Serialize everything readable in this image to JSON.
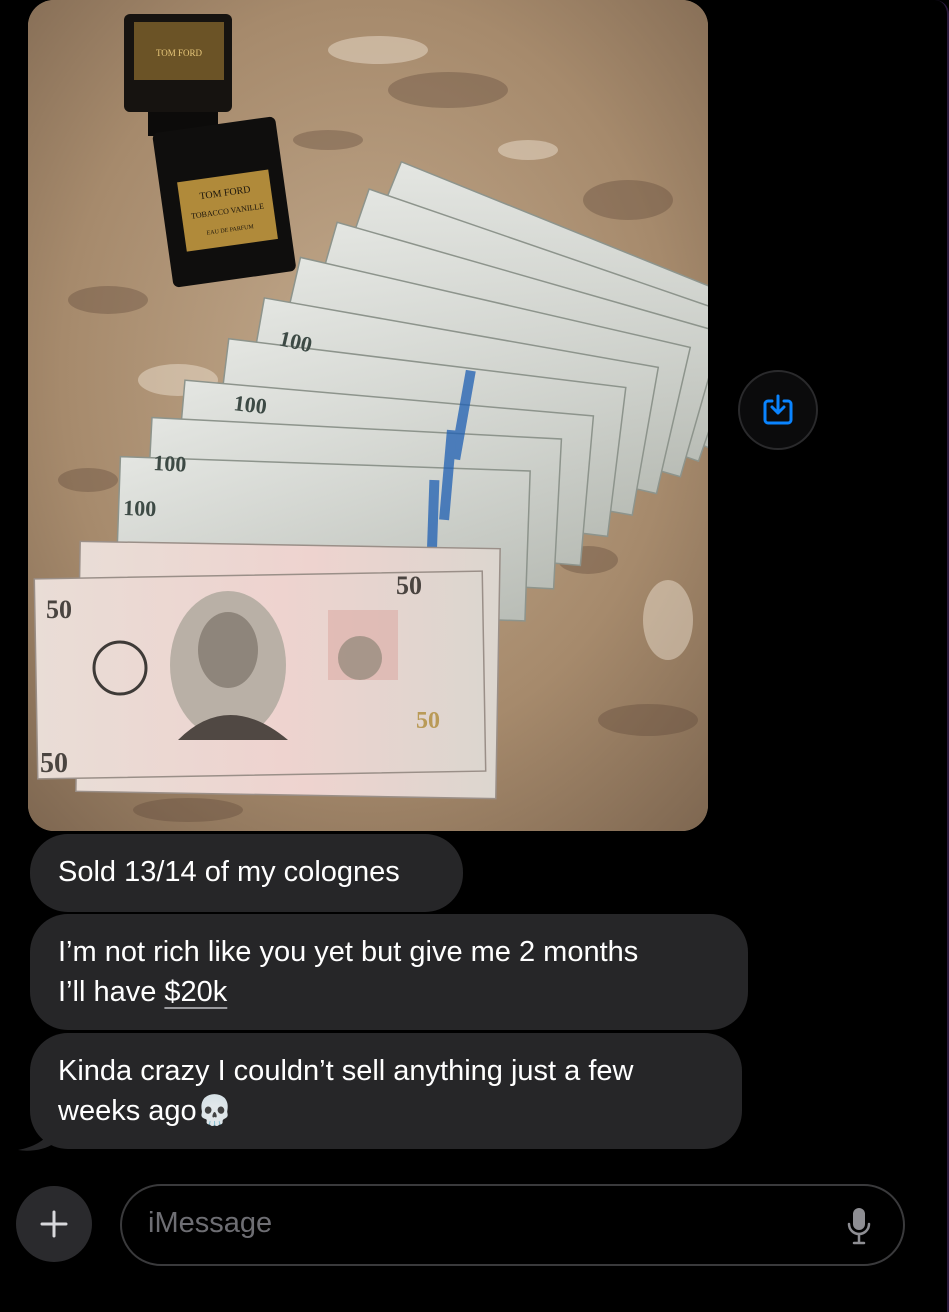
{
  "conversation": {
    "photo": {
      "alt": "Photo of a Tom Ford cologne bottle and a fan of cash on a granite counter",
      "bottle_brand": "TOM FORD",
      "bottle_name": "TOBACCO VANILLE",
      "bottle_sub": "EAU DE PARFUM",
      "bill_denominations": [
        "100",
        "50"
      ]
    },
    "messages": [
      {
        "lines": [
          "Sold 13/14 of my colognes"
        ]
      },
      {
        "lines": [
          "I’m not rich like you yet but give me 2 months",
          "I’ll have "
        ],
        "link": "$20k"
      },
      {
        "lines": [
          "Kinda crazy I couldn’t sell anything just a few",
          "weeks ago"
        ],
        "emoji": "💀"
      }
    ]
  },
  "composer": {
    "placeholder": "iMessage",
    "plus_icon": "plus-icon",
    "mic_icon": "microphone-icon",
    "save_icon": "save-to-photos-icon"
  },
  "colors": {
    "bubble_incoming": "#262628",
    "accent": "#0a84ff",
    "background": "#000000"
  }
}
